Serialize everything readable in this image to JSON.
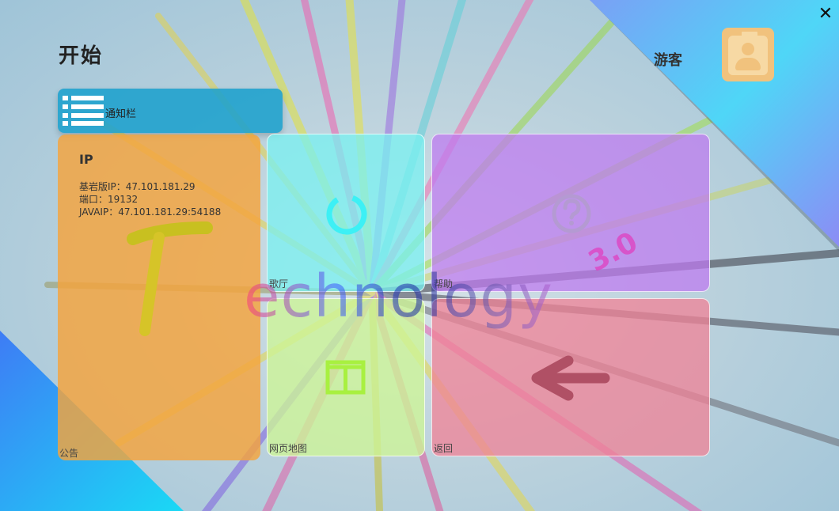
{
  "header": {
    "title": "开始",
    "user_name": "游客"
  },
  "window": {
    "close_symbol": "✕"
  },
  "notice_bar": {
    "label": "通知栏",
    "icon": "list-icon"
  },
  "ip_panel": {
    "title": "IP",
    "lines": [
      "基岩版IP：47.101.181.29",
      "端口：19132",
      "JAVAIP：47.101.181.29:54188"
    ],
    "label": "公告"
  },
  "tiles": [
    {
      "label": "歌厅",
      "icon": "loading-ring-icon"
    },
    {
      "label": "帮助",
      "icon": "question-circle-icon"
    },
    {
      "label": "网页地图",
      "icon": "window-grid-icon"
    },
    {
      "label": "返回",
      "icon": "arrow-left-icon"
    }
  ],
  "watermark": {
    "word": "Technology",
    "version": "3.0"
  },
  "colors": {
    "notice": "#1da0cd",
    "ip_panel": "#f5a43c",
    "lobby": "#78f0f0",
    "help": "#be78f0",
    "map": "#cdf596",
    "back": "#f08296"
  }
}
